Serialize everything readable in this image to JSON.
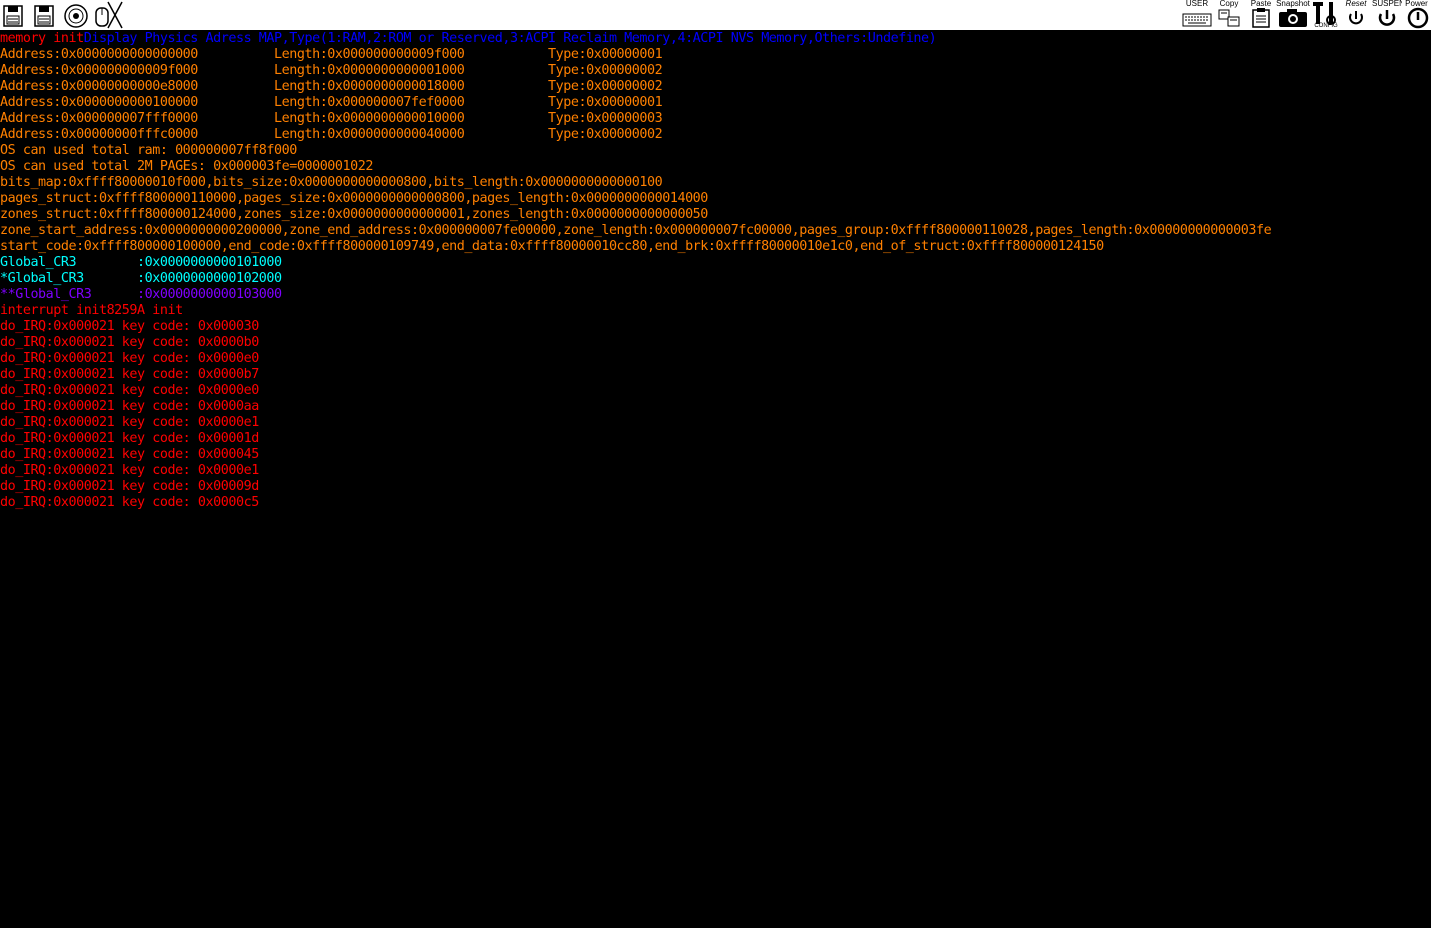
{
  "toolbar": {
    "left_icons": [
      "floppy-a-icon",
      "floppy-b-icon",
      "cdrom-icon",
      "mouse-icon"
    ],
    "user_label": "USER",
    "copy_label": "Copy",
    "paste_label": "Paste",
    "snapshot_label": "Snapshot",
    "config_label": "CONFIG",
    "reset_label": "Reset",
    "suspend_label": "SUSPEND",
    "power_label": "Power"
  },
  "colors": {
    "background": "#000000",
    "red": "#ff0000",
    "orange": "#ff8000",
    "blue": "#0000ff",
    "cyan": "#00ffff",
    "purple": "#7f00ff"
  },
  "console": {
    "lines": [
      {
        "segments": [
          {
            "text": "memory init",
            "color": "#ff0000"
          },
          {
            "text": "Display Physics Adress MAP,Type(1:RAM,2:ROM or Reserved,3:ACPI Reclaim Memory,4:ACPI NVS Memory,Others:Undefine)",
            "color": "#0000ff"
          }
        ]
      },
      {
        "segments": [
          {
            "text": "Address:0x0000000000000000\tLength:0x000000000009f000\tType:0x00000001",
            "color": "#ff8000"
          }
        ]
      },
      {
        "segments": [
          {
            "text": "Address:0x000000000009f000\tLength:0x0000000000001000\tType:0x00000002",
            "color": "#ff8000"
          }
        ]
      },
      {
        "segments": [
          {
            "text": "Address:0x00000000000e8000\tLength:0x0000000000018000\tType:0x00000002",
            "color": "#ff8000"
          }
        ]
      },
      {
        "segments": [
          {
            "text": "Address:0x0000000000100000\tLength:0x000000007fef0000\tType:0x00000001",
            "color": "#ff8000"
          }
        ]
      },
      {
        "segments": [
          {
            "text": "Address:0x000000007fff0000\tLength:0x0000000000010000\tType:0x00000003",
            "color": "#ff8000"
          }
        ]
      },
      {
        "segments": [
          {
            "text": "Address:0x00000000fffc0000\tLength:0x0000000000040000\tType:0x00000002",
            "color": "#ff8000"
          }
        ]
      },
      {
        "segments": [
          {
            "text": "OS can used total ram: 000000007ff8f000",
            "color": "#ff8000"
          }
        ]
      },
      {
        "segments": [
          {
            "text": "OS can used total 2M PAGEs: 0x000003fe=0000001022",
            "color": "#ff8000"
          }
        ]
      },
      {
        "segments": [
          {
            "text": "bits_map:0xffff80000010f000,bits_size:0x0000000000000800,bits_length:0x0000000000000100",
            "color": "#ff8000"
          }
        ]
      },
      {
        "segments": [
          {
            "text": "pages_struct:0xffff800000110000,pages_size:0x0000000000000800,pages_length:0x0000000000014000",
            "color": "#ff8000"
          }
        ]
      },
      {
        "segments": [
          {
            "text": "zones_struct:0xffff800000124000,zones_size:0x0000000000000001,zones_length:0x0000000000000050",
            "color": "#ff8000"
          }
        ]
      },
      {
        "segments": [
          {
            "text": "zone_start_address:0x0000000000200000,zone_end_address:0x000000007fe00000,zone_length:0x000000007fc00000,pages_group:0xffff800000110028,pages_length:0x00000000000003fe",
            "color": "#ff8000"
          }
        ]
      },
      {
        "segments": [
          {
            "text": "start_code:0xffff800000100000,end_code:0xffff800000109749,end_data:0xffff80000010cc80,end_brk:0xffff80000010e1c0,end_of_struct:0xffff800000124150",
            "color": "#ff8000"
          }
        ]
      },
      {
        "segments": [
          {
            "text": "Global_CR3\t:0x0000000000101000",
            "color": "#00ffff"
          }
        ]
      },
      {
        "segments": [
          {
            "text": "*Global_CR3\t:0x0000000000102000",
            "color": "#00ffff"
          }
        ]
      },
      {
        "segments": [
          {
            "text": "**Global_CR3\t:0x0000000000103000",
            "color": "#7f00ff"
          }
        ]
      },
      {
        "segments": [
          {
            "text": "interrupt init8259A init",
            "color": "#ff0000"
          }
        ]
      },
      {
        "segments": [
          {
            "text": "do_IRQ:0x000021 key code: 0x000030",
            "color": "#ff0000"
          }
        ]
      },
      {
        "segments": [
          {
            "text": "do_IRQ:0x000021 key code: 0x0000b0",
            "color": "#ff0000"
          }
        ]
      },
      {
        "segments": [
          {
            "text": "do_IRQ:0x000021 key code: 0x0000e0",
            "color": "#ff0000"
          }
        ]
      },
      {
        "segments": [
          {
            "text": "do_IRQ:0x000021 key code: 0x0000b7",
            "color": "#ff0000"
          }
        ]
      },
      {
        "segments": [
          {
            "text": "do_IRQ:0x000021 key code: 0x0000e0",
            "color": "#ff0000"
          }
        ]
      },
      {
        "segments": [
          {
            "text": "do_IRQ:0x000021 key code: 0x0000aa",
            "color": "#ff0000"
          }
        ]
      },
      {
        "segments": [
          {
            "text": "do_IRQ:0x000021 key code: 0x0000e1",
            "color": "#ff0000"
          }
        ]
      },
      {
        "segments": [
          {
            "text": "do_IRQ:0x000021 key code: 0x00001d",
            "color": "#ff0000"
          }
        ]
      },
      {
        "segments": [
          {
            "text": "do_IRQ:0x000021 key code: 0x000045",
            "color": "#ff0000"
          }
        ]
      },
      {
        "segments": [
          {
            "text": "do_IRQ:0x000021 key code: 0x0000e1",
            "color": "#ff0000"
          }
        ]
      },
      {
        "segments": [
          {
            "text": "do_IRQ:0x000021 key code: 0x00009d",
            "color": "#ff0000"
          }
        ]
      },
      {
        "segments": [
          {
            "text": "do_IRQ:0x000021 key code: 0x0000c5",
            "color": "#ff0000"
          }
        ]
      }
    ]
  }
}
